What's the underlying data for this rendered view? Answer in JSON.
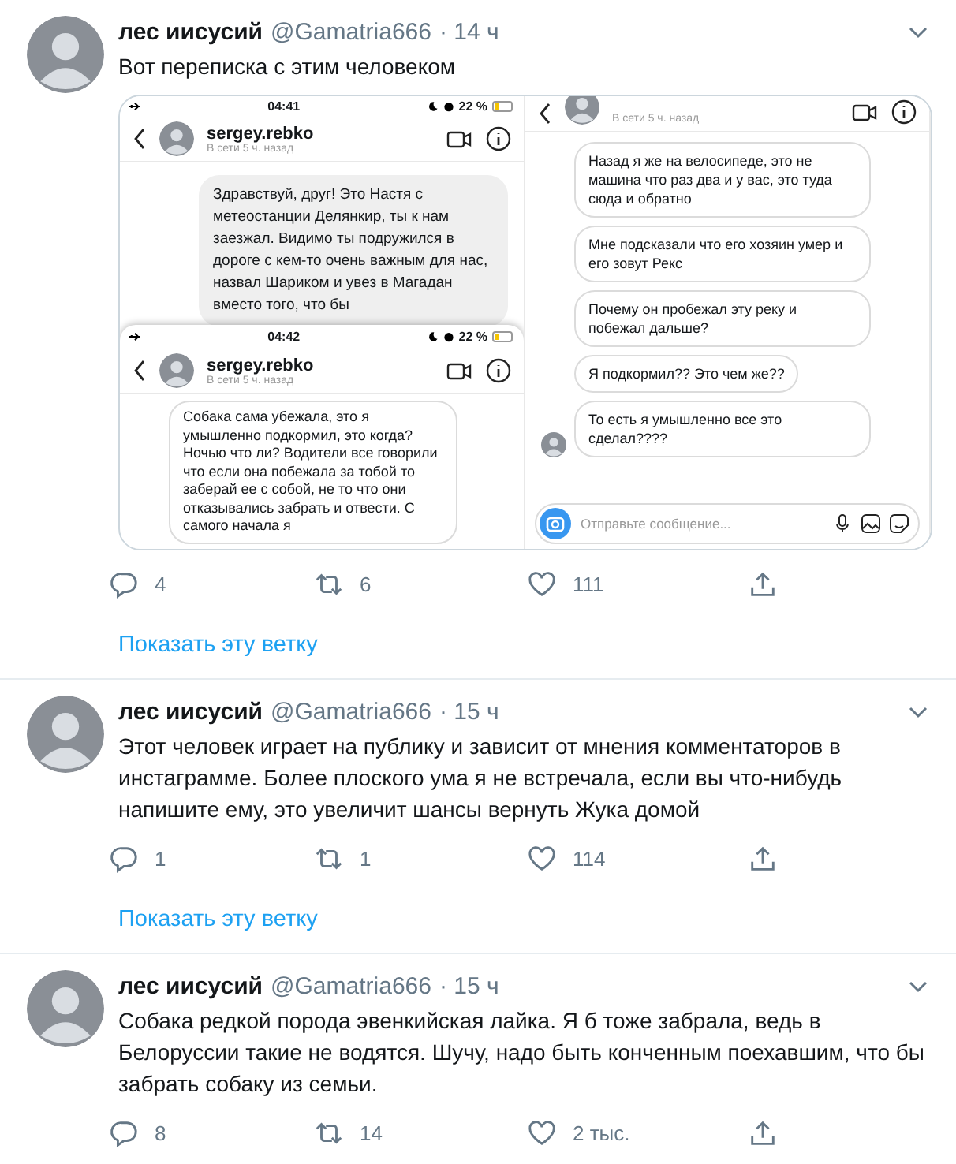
{
  "tweets": [
    {
      "author": "лес иисусий",
      "handle": "@Gamatria666",
      "time": "· 14 ч",
      "text": "Вот переписка с этим человеком",
      "media": {
        "columns": [
          {
            "screens": [
              {
                "status_time": "04:41",
                "battery": "22 %",
                "username": "sergey.rebko",
                "presence": "В сети 5 ч. назад",
                "messages": [
                  {
                    "kind": "sent",
                    "text": "Здравствуй, друг! Это Настя с метеостанции Делянкир, ты к нам заезжал. Видимо ты подружился в дороге с кем-то очень важным для нас, назвал Шариком и увез в Магадан вместо того, что бы"
                  }
                ]
              },
              {
                "status_time": "04:42",
                "battery": "22 %",
                "username": "sergey.rebko",
                "presence": "В сети 5 ч. назад",
                "messages": [
                  {
                    "kind": "received",
                    "text": "Собака сама убежала, это я умышленно подкормил, это когда? Ночью что ли? Водители все говорили что если она побежала за тобой то заберай ее с собой, не то что они отказывались забрать и отвести. С самого начала я"
                  }
                ]
              }
            ]
          },
          {
            "screens": [
              {
                "presence": "В сети 5 ч. назад",
                "input_placeholder": "Отправьте сообщение...",
                "messages": [
                  {
                    "kind": "received",
                    "avatar": false,
                    "text": "Назад я же на велосипеде, это не машина что раз два и у вас, это туда сюда и обратно"
                  },
                  {
                    "kind": "received",
                    "avatar": false,
                    "text": "Мне подсказали что его хозяин умер и его зовут Рекс"
                  },
                  {
                    "kind": "received",
                    "avatar": false,
                    "text": "Почему он пробежал эту реку и побежал дальше?"
                  },
                  {
                    "kind": "received",
                    "avatar": false,
                    "text": "Я подкормил?? Это чем же??"
                  },
                  {
                    "kind": "received",
                    "avatar": true,
                    "text": "То есть я умышленно все это сделал????"
                  }
                ]
              }
            ]
          }
        ]
      },
      "replies": "4",
      "retweets": "6",
      "likes": "111",
      "show_thread": "Показать эту ветку"
    },
    {
      "author": "лес иисусий",
      "handle": "@Gamatria666",
      "time": "· 15 ч",
      "text": "Этот человек играет на публику и зависит от мнения комментаторов в инстаграмме. Более плоского ума я не встречала, если вы что-нибудь напишите ему, это увеличит шансы вернуть Жука домой",
      "replies": "1",
      "retweets": "1",
      "likes": "114",
      "show_thread": "Показать эту ветку"
    },
    {
      "author": "лес иисусий",
      "handle": "@Gamatria666",
      "time": "· 15 ч",
      "text": "Собака редкой порода эвенкийская лайка. Я б тоже забрала, ведь в Белоруссии такие не водятся. Шучу, надо быть конченным поехавшим, что бы забрать собаку из семьи.",
      "replies": "8",
      "retweets": "14",
      "likes": "2 тыс."
    }
  ]
}
